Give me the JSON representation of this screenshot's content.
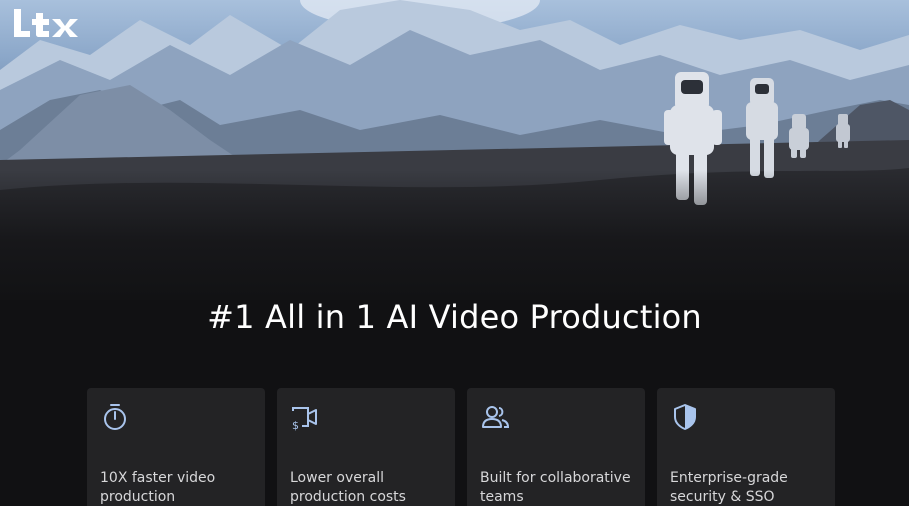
{
  "brand": {
    "logo_text": "Ltx"
  },
  "hero": {
    "headline": "#1 All in 1 AI Video Production"
  },
  "features": [
    {
      "icon": "stopwatch-icon",
      "label": "10X faster video production"
    },
    {
      "icon": "video-cost-icon",
      "label": "Lower overall production costs"
    },
    {
      "icon": "users-icon",
      "label": "Built for collaborative teams"
    },
    {
      "icon": "shield-icon",
      "label": "Enterprise-grade security & SSO"
    }
  ],
  "colors": {
    "background": "#111113",
    "card": "#232325",
    "icon_accent": "#a9c4ec",
    "text": "#ffffff"
  }
}
